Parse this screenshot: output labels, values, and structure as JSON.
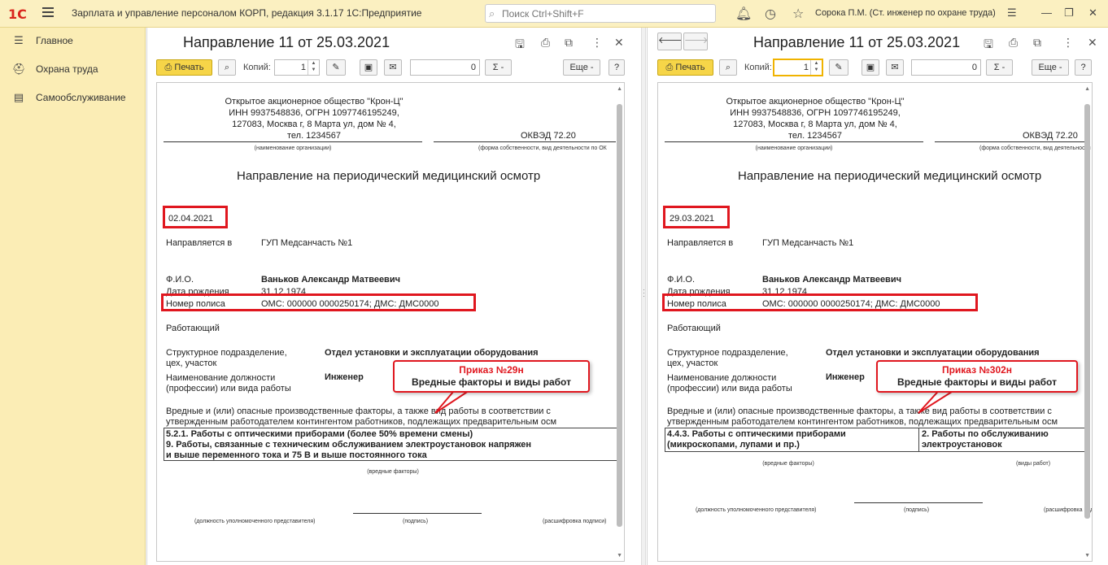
{
  "app": {
    "logo": "1С",
    "title": "Зарплата и управление персоналом КОРП, редакция 3.1.17 1С:Предприятие",
    "search_placeholder": "Поиск Ctrl+Shift+F",
    "user": "Сорока П.М. (Ст. инженер по охране труда)"
  },
  "sidebar": {
    "items": [
      {
        "label": "Главное",
        "icon": "menu-list-icon"
      },
      {
        "label": "Охрана труда",
        "icon": "hard-hat-icon"
      },
      {
        "label": "Самообслуживание",
        "icon": "id-card-icon"
      }
    ]
  },
  "toolbar": {
    "print": "Печать",
    "copies_label": "Копий:",
    "copies_value": "1",
    "sum_value": "0",
    "sigma": "Σ -",
    "more": "Еще -",
    "help": "?"
  },
  "panels": [
    {
      "title": "Направление 11 от 25.03.2021",
      "date": "02.04.2021",
      "callout_order": "Приказ №29н",
      "callout_text": "Вредные факторы и виды работ",
      "factors_line1": "5.2.1. Работы с оптическими приборами (более 50% времени смены)",
      "factors_line2": "9. Работы, связанные с техническим обслуживанием электроустановок напряжен",
      "factors_line3": "и выше переменного тока и 75 В и выше постоянного тока",
      "factors_caption": "(вредные факторы)"
    },
    {
      "title": "Направление 11 от 25.03.2021",
      "date": "29.03.2021",
      "callout_order": "Приказ №302н",
      "callout_text": "Вредные факторы и виды работ",
      "factors_left_1": "4.4.3. Работы с оптическими приборами",
      "factors_left_2": "(микроскопами, лупами и пр.)",
      "factors_right_1": "2. Работы по обслуживанию",
      "factors_right_2": "электроустановок",
      "factors_caption": "(вредные факторы)",
      "works_caption": "(виды работ)"
    }
  ],
  "doc": {
    "org1": "Открытое акционерное общество \"Крон-Ц\"",
    "org2": "ИНН 9937548836, ОГРН 1097746195249,",
    "org3": "127083, Москва г, 8 Марта ул, дом № 4,",
    "org4": "тел. 1234567",
    "okved": "ОКВЭД 72.20",
    "org_caption": "(наименование организации)",
    "form_caption": "(форма собственности, вид деятельности по ОК",
    "heading": "Направление на периодический медицинский осмотр",
    "sent_to_label": "Направляется в",
    "sent_to_value": "ГУП Медсанчасть №1",
    "fio_label": "Ф.И.О.",
    "fio_value": "Ваньков Александр Матвеевич",
    "birth_label": "Дата рождения",
    "birth_value": "31.12.1974",
    "policy_label": "Номер полиса",
    "policy_value": "ОМС: 000000 0000250174; ДМС: ДМС0000",
    "worker": "Работающий",
    "dept_label_1": "Структурное подразделение,",
    "dept_label_2": "цех, участок",
    "dept_value": "Отдел установки и эксплуатации оборудования",
    "pos_label_1": "Наименование должности",
    "pos_label_2": "(профессии) или вида работы",
    "pos_value": "Инженер",
    "harm_text_1": "Вредные и (или) опасные производственные факторы, а также вид работы в соответствии с",
    "harm_text_2": "утвержденным работодателем контингентом работников, подлежащих предварительным осм",
    "sig_caption_1": "(должность уполномоченного представителя)",
    "sig_caption_2": "(подпись)",
    "sig_caption_3": "(расшифровка подписи)"
  },
  "colors": {
    "accent_red": "#e0171f",
    "sidebar_bg": "#fbedb5",
    "print_button": "#f6d548"
  }
}
